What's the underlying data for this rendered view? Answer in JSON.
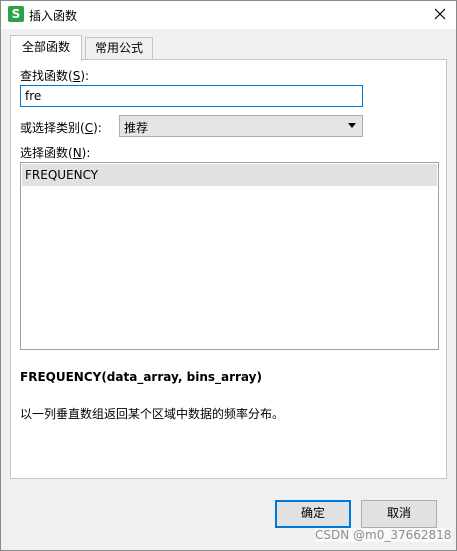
{
  "window": {
    "title": "插入函数",
    "app_icon_letter": "S",
    "app_icon_color": "#2ba245"
  },
  "tabs": [
    {
      "label": "全部函数",
      "active": true
    },
    {
      "label": "常用公式",
      "active": false
    }
  ],
  "search": {
    "label_prefix": "查找函数(",
    "label_key": "S",
    "label_suffix": "):",
    "value": "fre"
  },
  "category": {
    "label_prefix": "或选择类别(",
    "label_key": "C",
    "label_suffix": "):",
    "selected": "推荐"
  },
  "function_list": {
    "label_prefix": "选择函数(",
    "label_key": "N",
    "label_suffix": "):",
    "items": [
      "FREQUENCY"
    ]
  },
  "details": {
    "signature": "FREQUENCY(data_array, bins_array)",
    "description": "以一列垂直数组返回某个区域中数据的频率分布。"
  },
  "buttons": {
    "ok": "确定",
    "cancel": "取消"
  },
  "watermark": "CSDN @m0_37662818",
  "colors": {
    "focus_accent": "#0078d7"
  }
}
